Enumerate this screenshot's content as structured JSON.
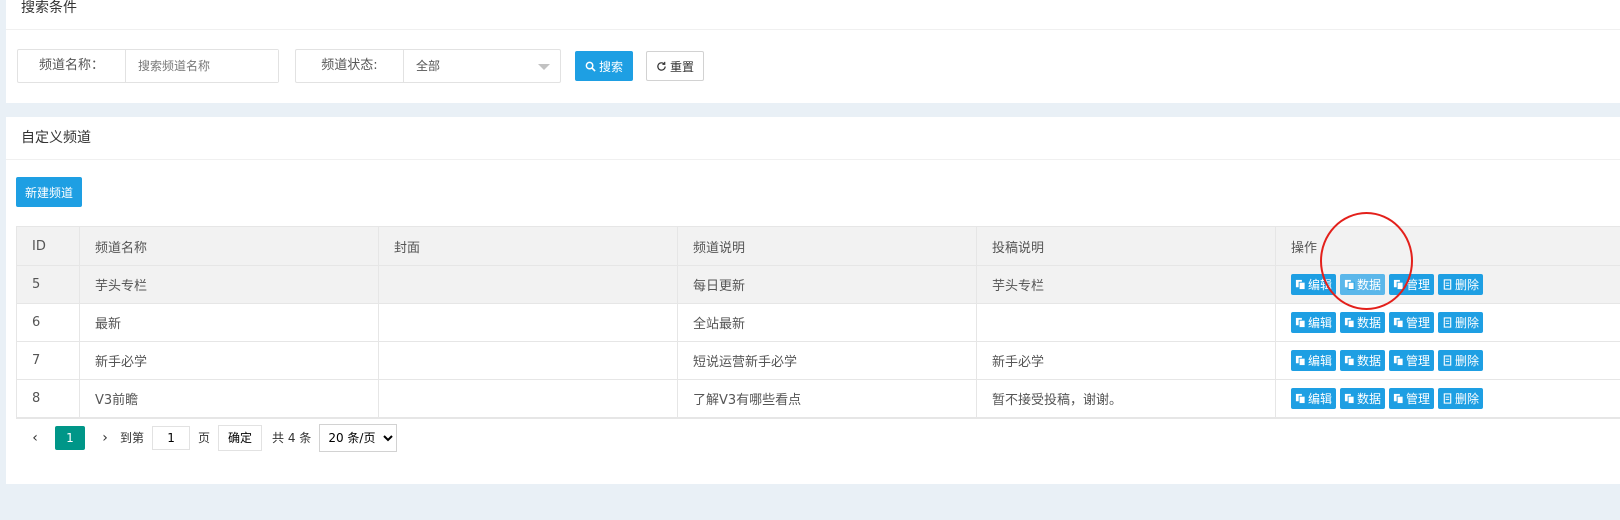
{
  "search_panel": {
    "title": "搜索条件",
    "name_label": "频道名称：",
    "name_placeholder": "搜索频道名称",
    "status_label": "频道状态:",
    "status_value": "全部",
    "search_button": "搜索",
    "reset_button": "重置"
  },
  "list_panel": {
    "title": "自定义频道",
    "new_button": "新建频道"
  },
  "table": {
    "headers": [
      "ID",
      "频道名称",
      "封面",
      "频道说明",
      "投稿说明",
      "操作"
    ],
    "rows": [
      {
        "id": "5",
        "name": "芋头专栏",
        "cover": "",
        "desc": "每日更新",
        "submit": "芋头专栏"
      },
      {
        "id": "6",
        "name": "最新",
        "cover": "",
        "desc": "全站最新",
        "submit": ""
      },
      {
        "id": "7",
        "name": "新手必学",
        "cover": "",
        "desc": "短说运营新手必学",
        "submit": "新手必学"
      },
      {
        "id": "8",
        "name": "V3前瞻",
        "cover": "",
        "desc": "了解V3有哪些看点",
        "submit": "暂不接受投稿，谢谢。"
      }
    ],
    "actions": [
      "编辑",
      "数据",
      "管理",
      "删除"
    ]
  },
  "pager": {
    "current": "1",
    "goto_label": "到第",
    "goto_value": "1",
    "page_label": "页",
    "confirm": "确定",
    "total": "共 4 条",
    "page_size": "20 条/页"
  },
  "colors": {
    "primary": "#1e9fe3",
    "pager_active": "#009688",
    "annotation_circle": "#e3201b"
  }
}
